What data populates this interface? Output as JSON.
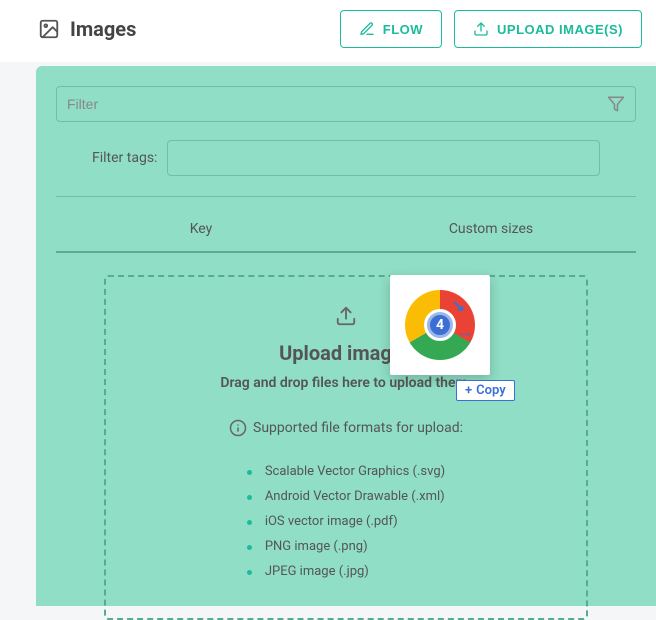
{
  "header": {
    "title": "Images",
    "flow_label": "FLOW",
    "upload_label": "UPLOAD IMAGE(S)"
  },
  "filter": {
    "placeholder": "Filter",
    "tags_label": "Filter tags:"
  },
  "table": {
    "col_key": "Key",
    "col_sizes": "Custom sizes"
  },
  "dropzone": {
    "title": "Upload images",
    "subtitle": "Drag and drop files here to upload them.",
    "formats_label": "Supported file formats for upload:",
    "formats": [
      "Scalable Vector Graphics (.svg)",
      "Android Vector Drawable (.xml)",
      "iOS vector image (.pdf)",
      "PNG image (.png)",
      "JPEG image (.jpg)"
    ]
  },
  "drag": {
    "count": "4",
    "copy_label": "Copy"
  }
}
